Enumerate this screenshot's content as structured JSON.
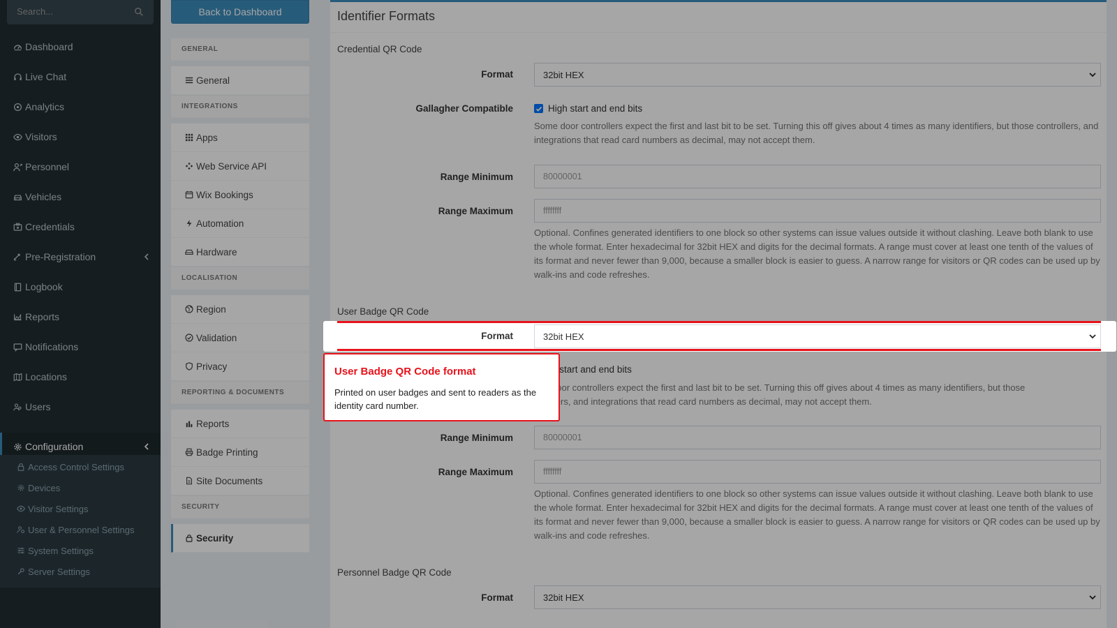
{
  "sidebar": {
    "search_placeholder": "Search...",
    "items": [
      {
        "label": "Dashboard",
        "icon": "dashboard-icon"
      },
      {
        "label": "Live Chat",
        "icon": "headset-icon"
      },
      {
        "label": "Analytics",
        "icon": "target-icon"
      },
      {
        "label": "Visitors",
        "icon": "eye-icon"
      },
      {
        "label": "Personnel",
        "icon": "user-tie-icon"
      },
      {
        "label": "Vehicles",
        "icon": "car-icon"
      },
      {
        "label": "Credentials",
        "icon": "id-card-icon"
      },
      {
        "label": "Pre-Registration",
        "icon": "exchange-icon"
      },
      {
        "label": "Logbook",
        "icon": "book-icon"
      },
      {
        "label": "Reports",
        "icon": "chart-area-icon"
      },
      {
        "label": "Notifications",
        "icon": "comment-icon"
      },
      {
        "label": "Locations",
        "icon": "map-icon"
      },
      {
        "label": "Users",
        "icon": "users-icon"
      },
      {
        "label": "Configuration",
        "icon": "gear-icon"
      }
    ],
    "submenu": [
      {
        "label": "Access Control Settings",
        "icon": "lock-icon"
      },
      {
        "label": "Devices",
        "icon": "cog-icon"
      },
      {
        "label": "Visitor Settings",
        "icon": "eye-icon"
      },
      {
        "label": "User & Personnel Settings",
        "icon": "users-cog-icon"
      },
      {
        "label": "System Settings",
        "icon": "sliders-icon"
      },
      {
        "label": "Server Settings",
        "icon": "server-cog-icon"
      }
    ]
  },
  "settings_nav": {
    "back_label": "Back to Dashboard",
    "sections": [
      {
        "title": "GENERAL",
        "items": [
          "General"
        ]
      },
      {
        "title": "INTEGRATIONS",
        "items": [
          "Apps",
          "Web Service API",
          "Wix Bookings",
          "Automation",
          "Hardware"
        ]
      },
      {
        "title": "LOCALISATION",
        "items": [
          "Region",
          "Validation",
          "Privacy"
        ]
      },
      {
        "title": "REPORTING & DOCUMENTS",
        "items": [
          "Reports",
          "Badge Printing",
          "Site Documents"
        ]
      },
      {
        "title": "SECURITY",
        "items": [
          "Security"
        ]
      }
    ]
  },
  "main": {
    "title": "Identifier Formats",
    "groups": [
      {
        "title": "Credential QR Code",
        "format_label": "Format",
        "format_value": "32bit HEX",
        "gallagher_label": "Gallagher Compatible",
        "gallagher_check": "High start and end bits",
        "gallagher_help": "Some door controllers expect the first and last bit to be set. Turning this off gives about 4 times as many identifiers, but those controllers, and integrations that read card numbers as decimal, may not accept them.",
        "range_min_label": "Range Minimum",
        "range_min_placeholder": "80000001",
        "range_max_label": "Range Maximum",
        "range_max_placeholder": "ffffffff",
        "range_help": "Optional. Confines generated identifiers to one block so other systems can issue values outside it without clashing. Leave both blank to use the whole format. Enter hexadecimal for 32bit HEX and digits for the decimal formats. A range must cover at least one tenth of the values of its format and never fewer than 9,000, because a smaller block is easier to guess. A narrow range for visitors or QR codes can be used up by walk-ins and code refreshes."
      },
      {
        "title": "User Badge QR Code",
        "format_label": "Format",
        "format_value": "32bit HEX",
        "gallagher_check_partial": "h start and end bits",
        "gallagher_help_line1": "door controllers expect the first and last bit to be set. Turning this off gives about 4 times as many identifiers, but those",
        "gallagher_help_line2": "llers, and integrations that read card numbers as decimal, may not accept them.",
        "range_min_label": "Range Minimum",
        "range_min_placeholder": "80000001",
        "range_max_label": "Range Maximum",
        "range_max_placeholder": "ffffffff",
        "range_help": "Optional. Confines generated identifiers to one block so other systems can issue values outside it without clashing. Leave both blank to use the whole format. Enter hexadecimal for 32bit HEX and digits for the decimal formats. A range must cover at least one tenth of the values of its format and never fewer than 9,000, because a smaller block is easier to guess. A narrow range for visitors or QR codes can be used up by walk-ins and code refreshes."
      },
      {
        "title": "Personnel Badge QR Code",
        "format_label": "Format",
        "format_value": "32bit HEX"
      }
    ]
  },
  "tooltip": {
    "title": "User Badge QR Code format",
    "body": "Printed on user badges and sent to readers as the identity card number."
  },
  "colors": {
    "sidebar_bg": "#222d32",
    "accent": "#3c8dbc",
    "highlight": "#e8121b",
    "checkbox": "#0075ff"
  }
}
